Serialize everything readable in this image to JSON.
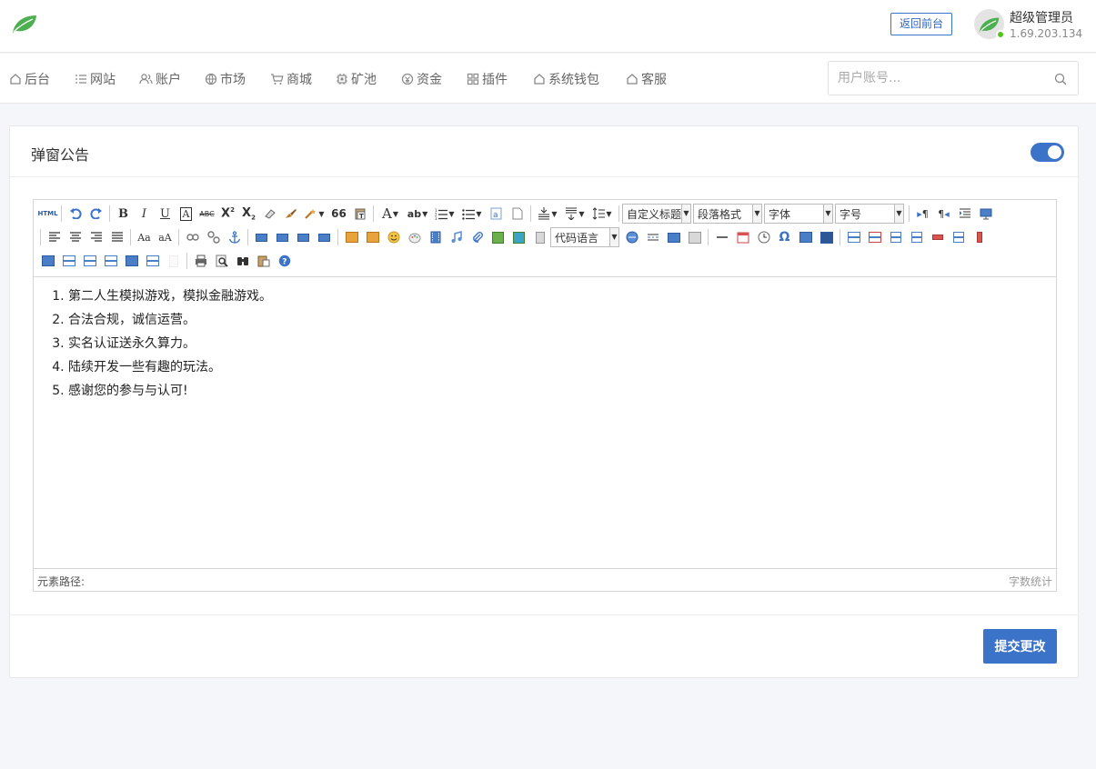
{
  "header": {
    "return_label": "返回前台",
    "user_name": "超级管理员",
    "user_ip": "1.69.203.134",
    "accent": "#3b73c9"
  },
  "nav": {
    "items": [
      {
        "label": "后台",
        "icon": "home-icon"
      },
      {
        "label": "网站",
        "icon": "list-icon"
      },
      {
        "label": "账户",
        "icon": "users-icon"
      },
      {
        "label": "市场",
        "icon": "globe-icon"
      },
      {
        "label": "商城",
        "icon": "cart-icon"
      },
      {
        "label": "矿池",
        "icon": "chip-icon"
      },
      {
        "label": "资金",
        "icon": "coin-icon"
      },
      {
        "label": "插件",
        "icon": "grid-icon"
      },
      {
        "label": "系统钱包",
        "icon": "home-icon"
      },
      {
        "label": "客服",
        "icon": "home-icon"
      }
    ],
    "search_placeholder": "用户账号..."
  },
  "card": {
    "title": "弹窗公告",
    "toggle_on": true,
    "submit_label": "提交更改"
  },
  "editor": {
    "toolbar": {
      "html_label": "HTML",
      "bold": "B",
      "italic": "I",
      "underline": "U",
      "strike": "ABC",
      "quote": "66",
      "custom_title": "自定义标题",
      "paragraph": "段落格式",
      "font": "字体",
      "font_size": "字号",
      "code_lang": "代码语言"
    },
    "content": [
      "第二人生模拟游戏，模拟金融游戏。",
      "合法合规，诚信运营。",
      "实名认证送永久算力。",
      "陆续开发一些有趣的玩法。",
      "感谢您的参与与认可!"
    ],
    "status_path": "元素路径:",
    "status_count": "字数统计"
  }
}
